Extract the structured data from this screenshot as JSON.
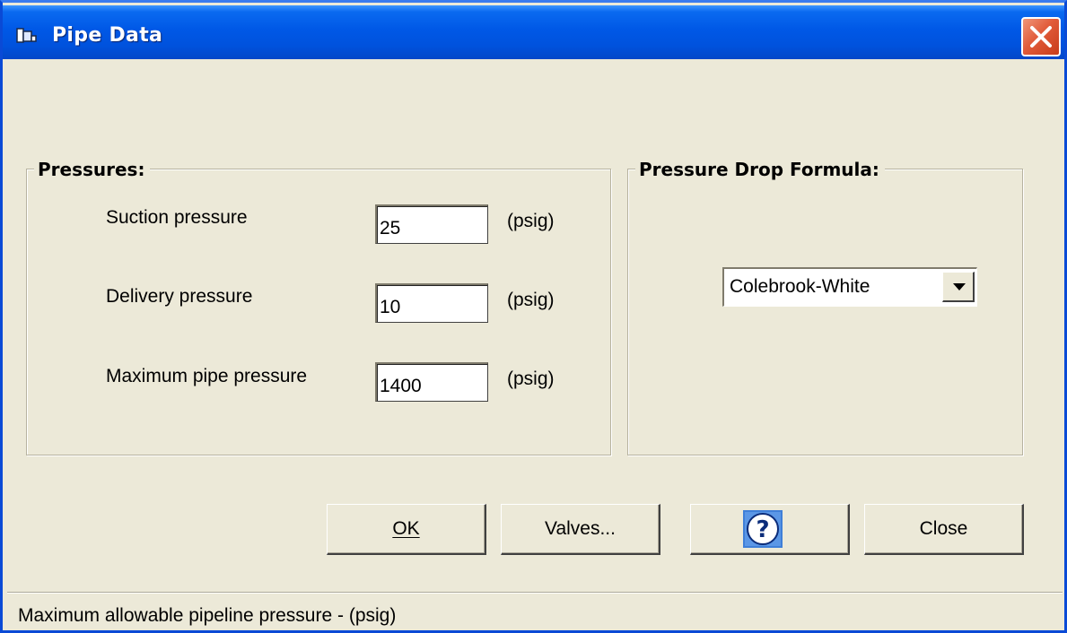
{
  "window": {
    "title": "Pipe Data",
    "icon": "app-window-icon",
    "close_icon": "close-icon"
  },
  "pressures_group": {
    "title": "Pressures:",
    "fields": [
      {
        "label": "Suction pressure",
        "value": "25",
        "unit": "(psig)"
      },
      {
        "label": "Delivery pressure",
        "value": "10",
        "unit": "(psig)"
      },
      {
        "label": "Maximum pipe pressure",
        "value": "1400",
        "unit": "(psig)"
      }
    ]
  },
  "formula_group": {
    "title": "Pressure Drop Formula:",
    "selected": "Colebrook-White",
    "dropdown_icon": "chevron-down-icon"
  },
  "buttons": {
    "ok": "OK",
    "valves": "Valves...",
    "help_icon": "help-icon",
    "close": "Close"
  },
  "status": {
    "text": "Maximum allowable pipeline pressure - (psig)"
  },
  "colors": {
    "title_bar": "#0058e6",
    "dialog_bg": "#ece9d8",
    "close_button": "#e15b3a",
    "help_icon": "#1560c8"
  }
}
